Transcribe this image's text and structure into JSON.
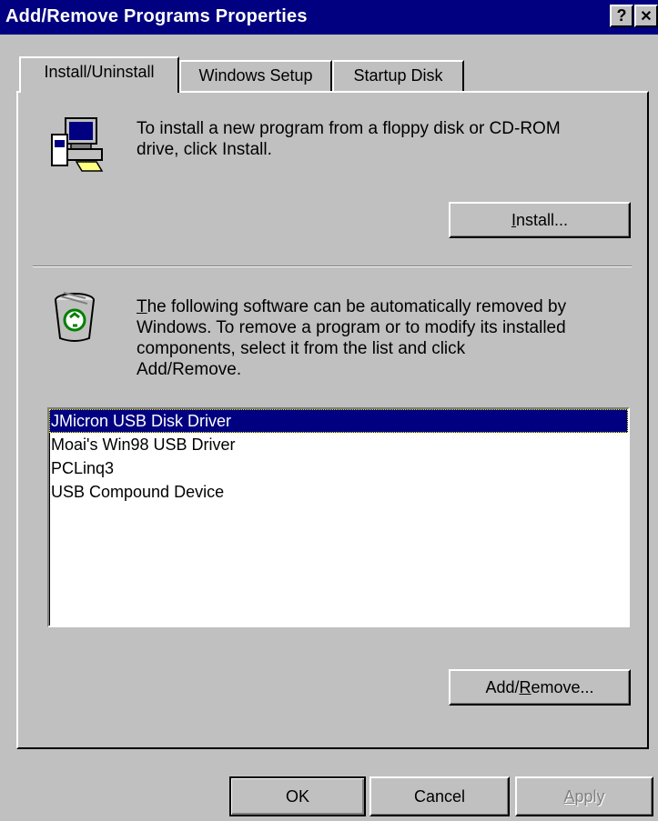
{
  "window": {
    "title": "Add/Remove Programs Properties",
    "help_button": "?",
    "close_button": "✕"
  },
  "tabs": [
    {
      "label": "Install/Uninstall",
      "active": true
    },
    {
      "label": "Windows Setup",
      "active": false
    },
    {
      "label": "Startup Disk",
      "active": false
    }
  ],
  "install_section": {
    "line1": "To install a new program from a floppy disk or CD-ROM",
    "line2": "drive, click Install.",
    "button_prefix": "",
    "button_mnemonic": "I",
    "button_rest": "nstall..."
  },
  "remove_section": {
    "line1_mnemonic": "T",
    "line1_rest": "he following software can be automatically removed by",
    "line2": "Windows. To remove a program or to modify its installed",
    "line3": "components, select it from the list and click",
    "line4": "Add/Remove.",
    "button_prefix": "Add/",
    "button_mnemonic": "R",
    "button_rest": "emove..."
  },
  "software_list": {
    "items": [
      {
        "label": "JMicron USB Disk Driver",
        "selected": true
      },
      {
        "label": "Moai's Win98 USB Driver",
        "selected": false
      },
      {
        "label": "PCLinq3",
        "selected": false
      },
      {
        "label": "USB Compound Device",
        "selected": false
      }
    ]
  },
  "footer": {
    "ok_label": "OK",
    "cancel_label": "Cancel",
    "apply_mnemonic": "A",
    "apply_rest": "pply"
  },
  "colors": {
    "title_bar": "#000080",
    "dialog_bg": "#c0c0c0",
    "selection": "#000080"
  },
  "icons": {
    "install": "computer-install-icon",
    "remove": "recycle-bin-icon"
  }
}
